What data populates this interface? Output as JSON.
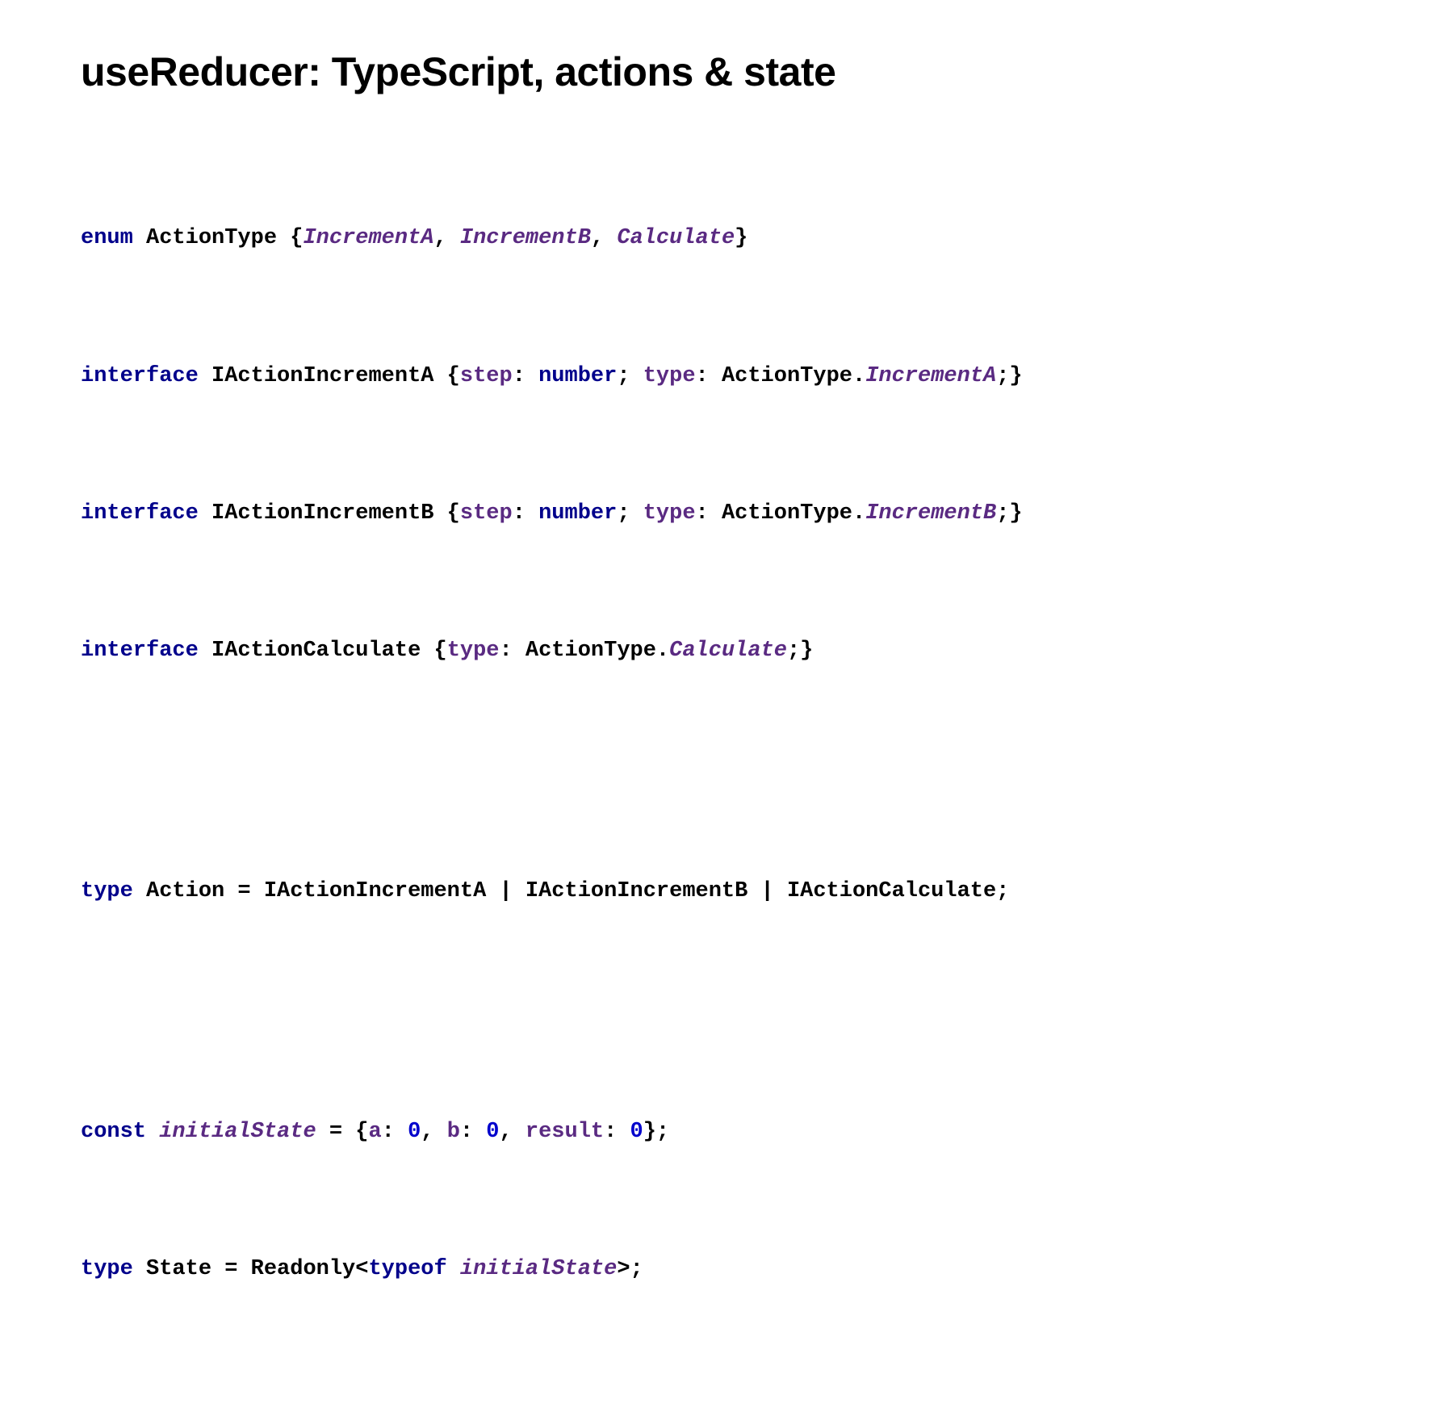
{
  "title": "useReducer: TypeScript, actions & state",
  "line1": {
    "kw": "enum",
    "name": " ActionType {",
    "m1": "IncrementA",
    "c1": ", ",
    "m2": "IncrementB",
    "c2": ", ",
    "m3": "Calculate",
    "close": "}"
  },
  "line2": {
    "kw": "interface",
    "name": " IActionIncrementA {",
    "p_step": "step",
    "t_sep1": ": ",
    "t_num": "number",
    "t_semi1": "; ",
    "p_type": "type",
    "t_sep2": ": ActionType.",
    "m": "IncrementA",
    "close": ";}"
  },
  "line3": {
    "kw": "interface",
    "name": " IActionIncrementB {",
    "p_step": "step",
    "t_sep1": ": ",
    "t_num": "number",
    "t_semi1": "; ",
    "p_type": "type",
    "t_sep2": ": ActionType.",
    "m": "IncrementB",
    "close": ";}"
  },
  "line4": {
    "kw": "interface",
    "name": " IActionCalculate {",
    "p_type": "type",
    "t_sep": ": ActionType.",
    "m": "Calculate",
    "close": ";}"
  },
  "line5": {
    "kw": "type",
    "rest": " Action = IActionIncrementA | IActionIncrementB | IActionCalculate;"
  },
  "line6": {
    "kw": "const",
    "sp": " ",
    "id": "initialState",
    "eq": " = {",
    "p_a": "a",
    "s_a": ": ",
    "v_a": "0",
    "c1": ", ",
    "p_b": "b",
    "s_b": ": ",
    "v_b": "0",
    "c2": ", ",
    "p_r": "result",
    "s_r": ": ",
    "v_r": "0",
    "close": "};"
  },
  "line7": {
    "kw": "type",
    "pre": " State = Readonly<",
    "to": "typeof",
    "sp": " ",
    "id": "initialState",
    "close": ">;"
  }
}
